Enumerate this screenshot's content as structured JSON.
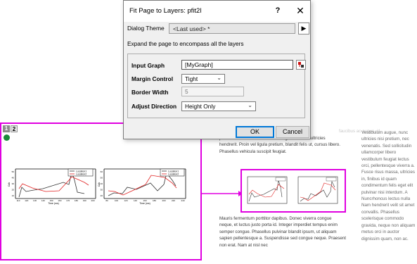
{
  "dialog": {
    "title": "Fit Page to Layers: pfit2l",
    "help_label": "?",
    "close_label": "✕",
    "theme_label": "Dialog Theme",
    "theme_value": "<Last used> *",
    "theme_arrow": "▶",
    "description": "Expand the page to encompass all the layers",
    "fields": {
      "input_graph_label": "Input Graph",
      "input_graph_value": "[MyGraph]",
      "margin_control_label": "Margin Control",
      "margin_control_value": "Tight",
      "border_width_label": "Border Width",
      "border_width_value": "5",
      "adjust_direction_label": "Adjust Direction",
      "adjust_direction_value": "Height Only"
    },
    "ok_label": "OK",
    "cancel_label": "Cancel"
  },
  "graph_window": {
    "layer_tabs": [
      "1",
      "2"
    ],
    "lock_icon": "layer-lock-icon",
    "border_color": "#e000e0",
    "legend": [
      "Location1",
      "Location2"
    ],
    "x_title": "Time (ms)",
    "y_title": "Cdk",
    "left_x_ticks": [
      "110",
      "120",
      "130",
      "140",
      "150",
      "160",
      "170",
      "180",
      "190",
      "200"
    ],
    "left_y_ticks": [
      "10",
      "20",
      "30",
      "40",
      "50"
    ],
    "right_x_ticks": [
      "80",
      "100",
      "120",
      "140",
      "160",
      "180",
      "200",
      "220",
      "240"
    ],
    "right_y_ticks": [
      "20",
      "30",
      "40",
      "50",
      "60"
    ],
    "series_colors": {
      "location1": "#333333",
      "location2": "#e02020"
    }
  },
  "text_page": {
    "top_partial": "placerat velit. Nullam convallis magna vitae elit ultricies hendrerit. Proin vel ligula pretium, blandit felis ut, cursus libero. Phasellus vehicula suscipit feugiat.",
    "top_faded": "faucibus ac augue, id",
    "bottom": "Mauris fermentum porttitor dapibus. Donec viverra congue neque, et luctus justo porta id. Integer imperdiet tempus enim semper congue. Phasellus pulvinar blandit ipsum, ut aliquam sapien pellentesque a. Suspendisse sed congue neque. Praesent non erat. Nam at nisl nec",
    "right_column_faded": "Vestibulum augue, nunc ultricies nisi pretium, nec venenatis. Sed sollicitudin ullamcorper libero vestibulum feugiat lectus orci, pellentesque viverra a. Fusce risus massa, ultricies in, finibus id quam condimentum felis eget elit pulvinar nisi interdum. A Nuncrhoncus lectus nulla Nam hendrerit velit sit amet convallis. Phasellus scelerisque commodo gravida, neque non aliquam metus orci in auctor dignissim quam, non ac."
  }
}
